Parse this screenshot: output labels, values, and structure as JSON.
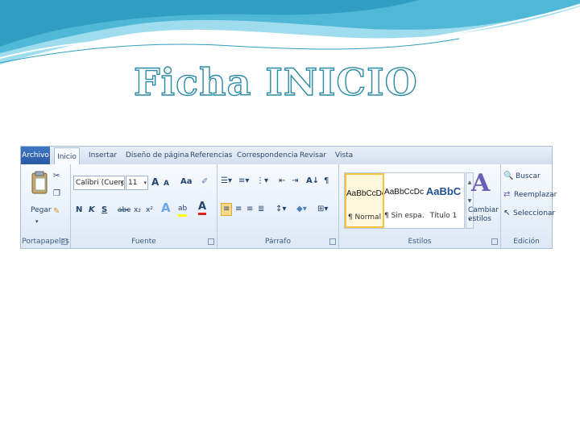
{
  "slide": {
    "title": "Ficha INICIO"
  },
  "ribbon": {
    "tabs": [
      "Archivo",
      "Inicio",
      "Insertar",
      "Diseño de página",
      "Referencias",
      "Correspondencia",
      "Revisar",
      "Vista"
    ],
    "clipboard": {
      "label": "Portapapeles",
      "paste": "Pegar"
    },
    "font": {
      "label": "Fuente",
      "font_name": "Calibri (Cuerpo)",
      "font_size": "11",
      "grow": "A",
      "shrink": "A",
      "case": "Aa",
      "bold": "N",
      "italic": "K",
      "underline": "S",
      "strike": "abc",
      "sub": "x₂",
      "super": "x²",
      "effects": "A",
      "highlight": "ab",
      "color": "A"
    },
    "paragraph": {
      "label": "Párrafo",
      "sort": "A↓",
      "marks": "¶"
    },
    "styles": {
      "label": "Estilos",
      "items": [
        {
          "sample": "AaBbCcDc",
          "name": "¶ Normal"
        },
        {
          "sample": "AaBbCcDc",
          "name": "¶ Sin espa..."
        },
        {
          "sample": "AaBbC",
          "name": "Título 1"
        }
      ],
      "change_styles": "Cambiar estilos"
    },
    "editing": {
      "label": "Edición",
      "find": "Buscar",
      "replace": "Reemplazar",
      "select": "Seleccionar"
    }
  },
  "colors": {
    "title_outline": "#2a8aa6",
    "ribbon_bg": "#dfe8f4",
    "selected_style": "#f5c342",
    "font_color_bar": "#e02020",
    "highlight_bar": "#ffff00"
  }
}
